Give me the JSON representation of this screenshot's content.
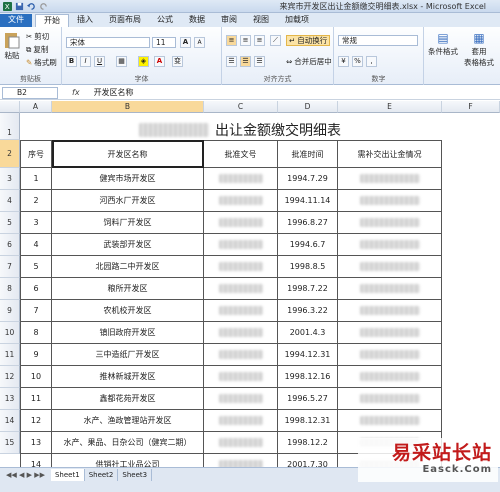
{
  "window": {
    "title": "来宾市开发区出让金额缴交明细表.xlsx - Microsoft Excel"
  },
  "ribbon_tabs": [
    "文件",
    "开始",
    "插入",
    "页面布局",
    "公式",
    "数据",
    "审阅",
    "视图",
    "加载项"
  ],
  "ribbon": {
    "clipboard": {
      "paste": "粘贴",
      "cut": "剪切",
      "copy": "复制",
      "format_painter": "格式刷",
      "label": "剪贴板"
    },
    "font": {
      "name": "宋体",
      "size": "11",
      "label": "字体",
      "bold": "B",
      "italic": "I",
      "underline": "U",
      "color_letter": "A",
      "grow": "A",
      "shrink": "A",
      "phonetic": "变"
    },
    "alignment": {
      "wrap": "自动换行",
      "merge": "合并后居中",
      "label": "对齐方式"
    },
    "number": {
      "format": "常规",
      "percent": "%",
      "comma": ",",
      "label": "数字"
    },
    "styles": {
      "conditional": "条件格式",
      "table": "套用\n表格格式"
    }
  },
  "formula_bar": {
    "name_box": "B2",
    "fx": "fx",
    "value": "开发区名称"
  },
  "columns": [
    "A",
    "B",
    "C",
    "D",
    "E",
    "F"
  ],
  "sheet": {
    "title": "出让金额缴交明细表",
    "headers": [
      "序号",
      "开发区名称",
      "批准文号",
      "批准时间",
      "需补交出让金情况"
    ],
    "rows": [
      {
        "no": "1",
        "name": "健宾市场开发区",
        "date": "1994.7.29"
      },
      {
        "no": "2",
        "name": "河西水厂开发区",
        "date": "1994.11.14"
      },
      {
        "no": "3",
        "name": "饲料厂开发区",
        "date": "1996.8.27"
      },
      {
        "no": "4",
        "name": "武装部开发区",
        "date": "1994.6.7"
      },
      {
        "no": "5",
        "name": "北园路二中开发区",
        "date": "1998.8.5"
      },
      {
        "no": "6",
        "name": "粮所开发区",
        "date": "1998.7.22"
      },
      {
        "no": "7",
        "name": "农机校开发区",
        "date": "1996.3.22"
      },
      {
        "no": "8",
        "name": "镇旧政府开发区",
        "date": "2001.4.3"
      },
      {
        "no": "9",
        "name": "三中造纸厂开发区",
        "date": "1994.12.31"
      },
      {
        "no": "10",
        "name": "推林新城开发区",
        "date": "1998.12.16"
      },
      {
        "no": "11",
        "name": "鑫都花苑开发区",
        "date": "1996.5.27"
      },
      {
        "no": "12",
        "name": "水产、渔政管理站开发区",
        "date": "1998.12.31"
      },
      {
        "no": "13",
        "name": "水产、果品、日杂公司（健宾二期）",
        "date": "1998.12.2"
      },
      {
        "no": "14",
        "name": "供销社工业品公司",
        "date": "2001.7.30"
      }
    ],
    "row_numbers": [
      "1",
      "2",
      "3",
      "4",
      "5",
      "6",
      "7",
      "8",
      "9",
      "10",
      "11",
      "12",
      "13",
      "14",
      "15"
    ]
  },
  "sheet_tabs": [
    "Sheet1",
    "Sheet2",
    "Sheet3"
  ],
  "watermark": {
    "cn": "易采站长站",
    "en": "Easck.Com"
  }
}
